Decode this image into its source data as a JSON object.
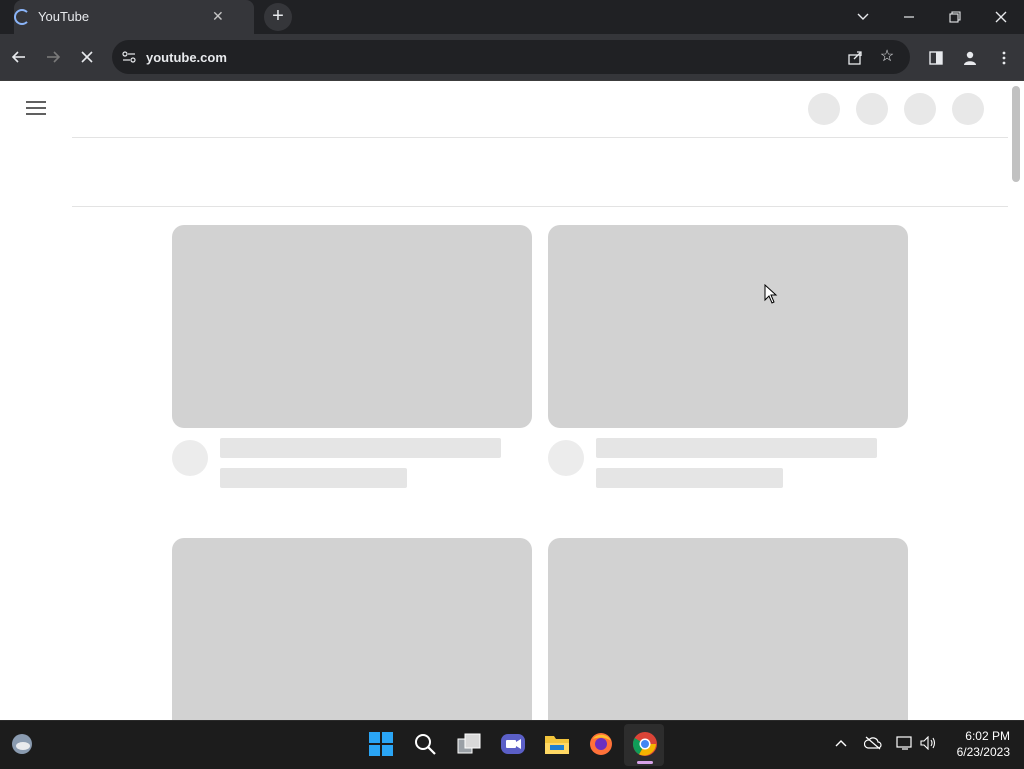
{
  "browser": {
    "tab_title": "YouTube",
    "url": "youtube.com",
    "window_controls": [
      "chevron-down-icon",
      "minimize-icon",
      "restore-icon",
      "close-icon"
    ],
    "toolbar_icons": [
      "back-arrow-icon",
      "forward-arrow-icon",
      "stop-loading-icon",
      "share-icon",
      "star-icon",
      "side-panel-icon",
      "profile-icon",
      "kebab-menu-icon"
    ]
  },
  "page": {
    "state": "loading-skeleton",
    "colors": {
      "skeleton_thumb": "#d2d2d2",
      "skeleton_bar": "#e5e5e5",
      "skeleton_avatar": "#ececec"
    }
  },
  "taskbar": {
    "apps": [
      "windows-start-icon",
      "search-icon",
      "task-view-icon",
      "video-call-icon",
      "file-explorer-icon",
      "firefox-icon",
      "chrome-icon"
    ],
    "time": "6:02 PM",
    "date": "6/23/2023"
  }
}
